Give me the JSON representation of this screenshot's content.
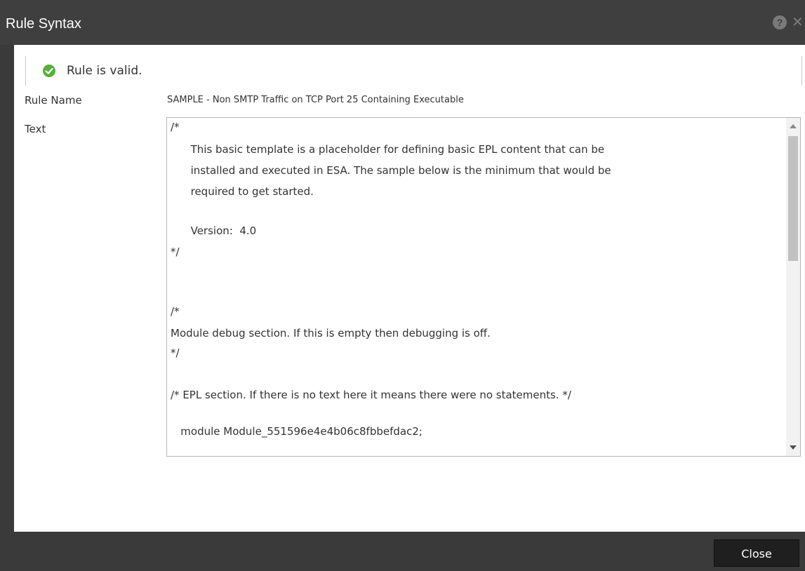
{
  "dialog": {
    "title": "Rule Syntax",
    "help_icon": "question-circle-icon",
    "close_icon": "close-icon"
  },
  "status": {
    "icon": "check-circle-icon",
    "text": "Rule is valid.",
    "color": "#56b03a"
  },
  "fields": {
    "rule_name_label": "Rule Name",
    "rule_name_value": "SAMPLE - Non SMTP Traffic on TCP Port 25 Containing Executable",
    "text_label": "Text"
  },
  "text_content": [
    "/*",
    "      This basic template is a placeholder for defining basic EPL content that can be",
    "      installed and executed in ESA. The sample below is the minimum that would be",
    "      required to get started.",
    "",
    "      Version:  4.0",
    "*/",
    "",
    "",
    "",
    "/*",
    "Module debug section. If this is empty then debugging is off.",
    "*/",
    "",
    "/* EPL section. If there is no text here it means there were no statements. */",
    "",
    "   module Module_551596e4e4b06c8fbbefdac2;"
  ],
  "footer": {
    "close_label": "Close"
  }
}
